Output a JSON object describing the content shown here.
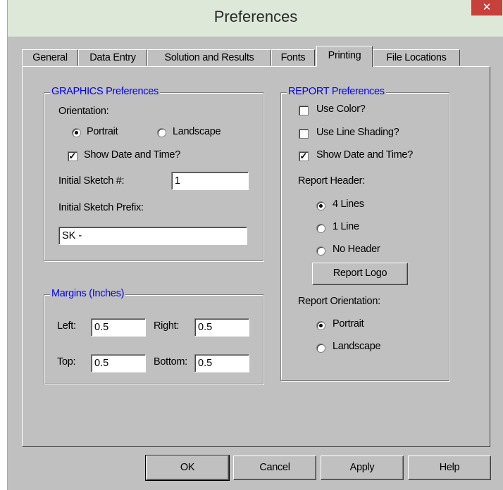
{
  "window": {
    "title": "Preferences",
    "close": "✕"
  },
  "tabs": [
    "General",
    "Data Entry",
    "Solution and Results",
    "Fonts",
    "Printing",
    "File Locations"
  ],
  "graphics": {
    "legend": "GRAPHICS Preferences",
    "orientation_label": "Orientation:",
    "portrait": "Portrait",
    "landscape": "Landscape",
    "orientation_selected": "Portrait",
    "show_date_time": "Show Date and Time?",
    "show_date_time_checked": true,
    "initial_sketch_num_label": "Initial Sketch #:",
    "initial_sketch_num_value": "1",
    "initial_sketch_prefix_label": "Initial Sketch Prefix:",
    "initial_sketch_prefix_value": "SK -"
  },
  "margins": {
    "legend": "Margins (Inches)",
    "left_label": "Left:",
    "left_value": "0.5",
    "right_label": "Right:",
    "right_value": "0.5",
    "top_label": "Top:",
    "top_value": "0.5",
    "bottom_label": "Bottom:",
    "bottom_value": "0.5"
  },
  "report": {
    "legend": "REPORT Preferences",
    "use_color": "Use Color?",
    "use_color_checked": false,
    "use_line_shading": "Use Line Shading?",
    "use_line_shading_checked": false,
    "show_date_time": "Show Date and Time?",
    "show_date_time_checked": true,
    "header_label": "Report Header:",
    "four_lines": "4 Lines",
    "one_line": "1 Line",
    "no_header": "No Header",
    "header_selected": "4 Lines",
    "report_logo": "Report Logo",
    "orientation_label": "Report Orientation:",
    "portrait": "Portrait",
    "landscape": "Landscape",
    "orientation_selected": "Portrait"
  },
  "buttons": {
    "ok": "OK",
    "cancel": "Cancel",
    "apply": "Apply",
    "help": "Help"
  }
}
